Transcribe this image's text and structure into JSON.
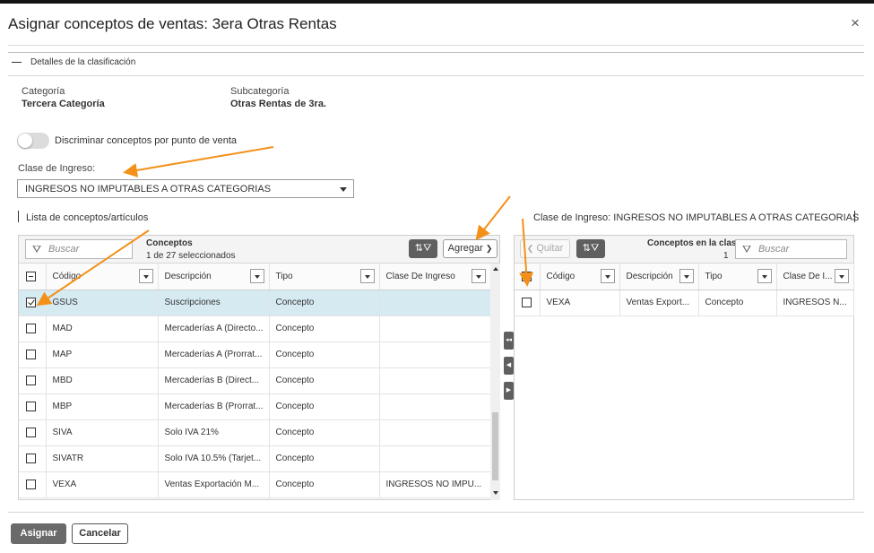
{
  "dialog": {
    "title": "Asignar conceptos de ventas: 3era Otras Rentas",
    "close_icon": "×"
  },
  "details": {
    "section_title": "Detalles de la clasificación",
    "category_label": "Categoría",
    "category_value": "Tercera Categoría",
    "subcategory_label": "Subcategoría",
    "subcategory_value": "Otras Rentas de 3ra."
  },
  "toggle": {
    "label": "Discriminar conceptos por punto de venta",
    "on": false
  },
  "income_class": {
    "label": "Clase de Ingreso:",
    "selected": "INGRESOS NO IMPUTABLES A OTRAS CATEGORIAS"
  },
  "left_panel": {
    "title": "Lista de conceptos/artículos",
    "search_placeholder": "Buscar",
    "counter_title": "Conceptos",
    "counter_text": "1 de 27 seleccionados",
    "filter_icon": "filter-sort-icon",
    "add_button": "Agregar",
    "add_chevron": "❯",
    "columns": [
      "Código",
      "Descripción",
      "Tipo",
      "Clase De Ingreso"
    ],
    "rows": [
      {
        "checked": true,
        "code": "GSUS",
        "desc": "Suscripciones",
        "type": "Concepto",
        "class": ""
      },
      {
        "checked": false,
        "code": "MAD",
        "desc": "Mercaderías A (Directo...",
        "type": "Concepto",
        "class": ""
      },
      {
        "checked": false,
        "code": "MAP",
        "desc": "Mercaderías A (Prorrat...",
        "type": "Concepto",
        "class": ""
      },
      {
        "checked": false,
        "code": "MBD",
        "desc": "Mercaderías B (Direct...",
        "type": "Concepto",
        "class": ""
      },
      {
        "checked": false,
        "code": "MBP",
        "desc": "Mercaderías B (Prorrat...",
        "type": "Concepto",
        "class": ""
      },
      {
        "checked": false,
        "code": "SIVA",
        "desc": "Solo IVA 21%",
        "type": "Concepto",
        "class": ""
      },
      {
        "checked": false,
        "code": "SIVATR",
        "desc": "Solo IVA 10.5% (Tarjet...",
        "type": "Concepto",
        "class": ""
      },
      {
        "checked": false,
        "code": "VEXA",
        "desc": "Ventas Exportación M...",
        "type": "Concepto",
        "class": "INGRESOS NO IMPU..."
      }
    ]
  },
  "right_panel": {
    "title": "Clase de Ingreso: INGRESOS NO IMPUTABLES A OTRAS CATEGORIAS",
    "remove_button": "Quitar",
    "remove_chevron": "❮",
    "counter_title": "Conceptos en la clase",
    "counter_value": "1",
    "search_placeholder": "Buscar",
    "columns": [
      "Código",
      "Descripción",
      "Tipo",
      "Clase De I..."
    ],
    "rows": [
      {
        "checked": false,
        "code": "VEXA",
        "desc": "Ventas Export...",
        "type": "Concepto",
        "class": "INGRESOS N..."
      }
    ]
  },
  "movers": {
    "collapse": "◂◂",
    "move_left": "◀",
    "move_right": "▶"
  },
  "footer": {
    "assign": "Asignar",
    "cancel": "Cancelar"
  },
  "colors": {
    "annotation": "#f39019",
    "selected_row": "#d6eaf2",
    "dark_button": "#5f5f5f"
  }
}
